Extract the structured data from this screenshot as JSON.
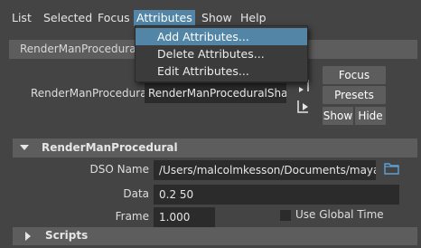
{
  "menubar": {
    "items": [
      "List",
      "Selected",
      "Focus",
      "Attributes",
      "Show",
      "Help"
    ],
    "active": "Attributes"
  },
  "panel": {
    "title": "RenderManProcedural"
  },
  "node": {
    "label": "RenderManProcedural:",
    "value": "RenderManProceduralShape"
  },
  "buttons": {
    "focus": "Focus",
    "presets": "Presets",
    "show": "Show",
    "hide": "Hide"
  },
  "section": {
    "title": "RenderManProcedural"
  },
  "attributes": {
    "dso_name_label": "DSO Name",
    "dso_name_value": "/Users/malcolmkesson/Documents/maya/rfr",
    "data_label": "Data",
    "data_value": "0.2 50",
    "frame_label": "Frame",
    "frame_value": "1.000",
    "use_global_time_label": "Use Global Time",
    "use_global_time_checked": false
  },
  "scripts": {
    "title": "Scripts"
  },
  "dropdown": {
    "items": [
      "Add Attributes...",
      "Delete Attributes...",
      "Edit Attributes..."
    ],
    "highlighted_index": 0
  },
  "colors": {
    "background": "#444444",
    "highlight": "#5285a6",
    "field": "#2b2b2b",
    "button": "#5d5d5d",
    "folder_icon": "#5fa0d8"
  }
}
